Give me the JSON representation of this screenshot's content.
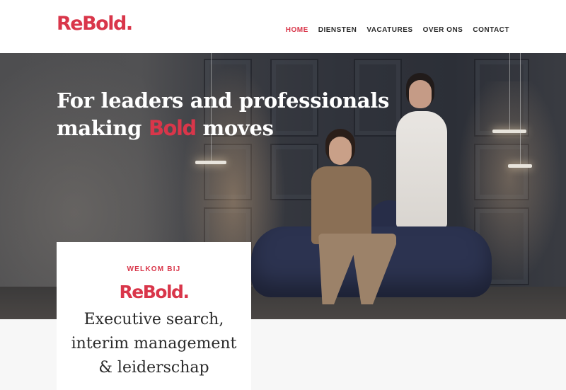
{
  "brand": {
    "name": "ReBold.",
    "color": "#d9364a"
  },
  "nav": {
    "items": [
      {
        "label": "HOME",
        "active": true
      },
      {
        "label": "DIENSTEN",
        "active": false
      },
      {
        "label": "VACATURES",
        "active": false
      },
      {
        "label": "OVER ONS",
        "active": false
      },
      {
        "label": "CONTACT",
        "active": false
      }
    ]
  },
  "hero": {
    "title_part1": "For leaders and professionals making ",
    "title_highlight": "Bold",
    "title_part2": " moves"
  },
  "card": {
    "eyebrow": "WELKOM BIJ",
    "logo": "ReBold.",
    "heading_line1": "Executive search,",
    "heading_line2": "interim management",
    "heading_line3": "& leiderschap"
  }
}
